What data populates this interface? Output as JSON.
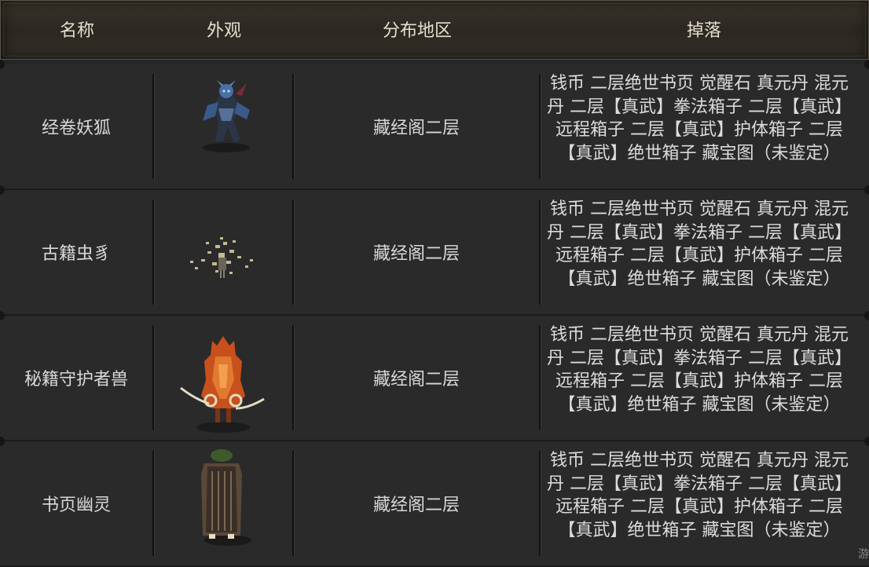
{
  "columns": [
    "名称",
    "外观",
    "分布地区",
    "掉落"
  ],
  "rows": [
    {
      "name": "经卷妖狐",
      "appearance_icon": "fox-demon-sprite",
      "location": "藏经阁二层",
      "drops": "钱币 二层绝世书页 觉醒石 真元丹 混元丹 二层【真武】拳法箱子 二层【真武】远程箱子 二层【真武】护体箱子 二层【真武】绝世箱子 藏宝图（未鉴定）"
    },
    {
      "name": "古籍虫豸",
      "appearance_icon": "paper-insect-swarm-sprite",
      "location": "藏经阁二层",
      "drops": "钱币 二层绝世书页 觉醒石 真元丹 混元丹 二层【真武】拳法箱子 二层【真武】远程箱子 二层【真武】护体箱子 二层【真武】绝世箱子 藏宝图（未鉴定）"
    },
    {
      "name": "秘籍守护者兽",
      "appearance_icon": "fire-guardian-beast-sprite",
      "location": "藏经阁二层",
      "drops": "钱币 二层绝世书页 觉醒石 真元丹 混元丹 二层【真武】拳法箱子 二层【真武】远程箱子 二层【真武】护体箱子 二层【真武】绝世箱子 藏宝图（未鉴定）"
    },
    {
      "name": "书页幽灵",
      "appearance_icon": "cloaked-page-ghost-sprite",
      "location": "藏经阁二层",
      "drops": "钱币 二层绝世书页 觉醒石 真元丹 混元丹 二层【真武】拳法箱子 二层【真武】远程箱子 二层【真武】护体箱子 二层【真武】绝世箱子 藏宝图（未鉴定）"
    }
  ],
  "watermark": "游"
}
